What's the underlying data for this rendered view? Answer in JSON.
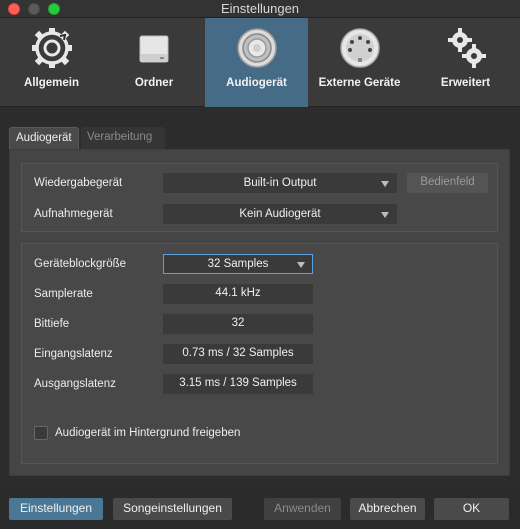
{
  "window": {
    "title": "Einstellungen"
  },
  "toolbar": {
    "items": [
      {
        "label": "Allgemein",
        "icon": "gear-cycle-icon"
      },
      {
        "label": "Ordner",
        "icon": "drive-icon"
      },
      {
        "label": "Audiogerät",
        "icon": "speaker-icon"
      },
      {
        "label": "Externe Geräte",
        "icon": "midi-connector-icon"
      },
      {
        "label": "Erweitert",
        "icon": "gears-icon"
      }
    ],
    "active_index": 2
  },
  "tabs": [
    {
      "label": "Audiogerät",
      "active": true
    },
    {
      "label": "Verarbeitung",
      "active": false
    }
  ],
  "device": {
    "playback_label": "Wiedergabegerät",
    "playback_value": "Built-in Output",
    "control_panel_button": "Bedienfeld",
    "record_label": "Aufnahmegerät",
    "record_value": "Kein Audiogerät"
  },
  "settings": {
    "block_size_label": "Geräteblockgröße",
    "block_size_value": "32 Samples",
    "samplerate_label": "Samplerate",
    "samplerate_value": "44.1 kHz",
    "bitdepth_label": "Bittiefe",
    "bitdepth_value": "32",
    "input_latency_label": "Eingangslatenz",
    "input_latency_value": "0.73 ms / 32 Samples",
    "output_latency_label": "Ausgangslatenz",
    "output_latency_value": "3.15 ms / 139 Samples",
    "release_checkbox_label": "Audiogerät im Hintergrund freigeben",
    "release_checkbox_checked": false
  },
  "footer": {
    "settings_button": "Einstellungen",
    "song_settings_button": "Songeinstellungen",
    "apply_button": "Anwenden",
    "cancel_button": "Abbrechen",
    "ok_button": "OK"
  },
  "colors": {
    "accent": "#456b86",
    "primary_button": "#4a7894",
    "focus_border": "#5aa0e0"
  }
}
